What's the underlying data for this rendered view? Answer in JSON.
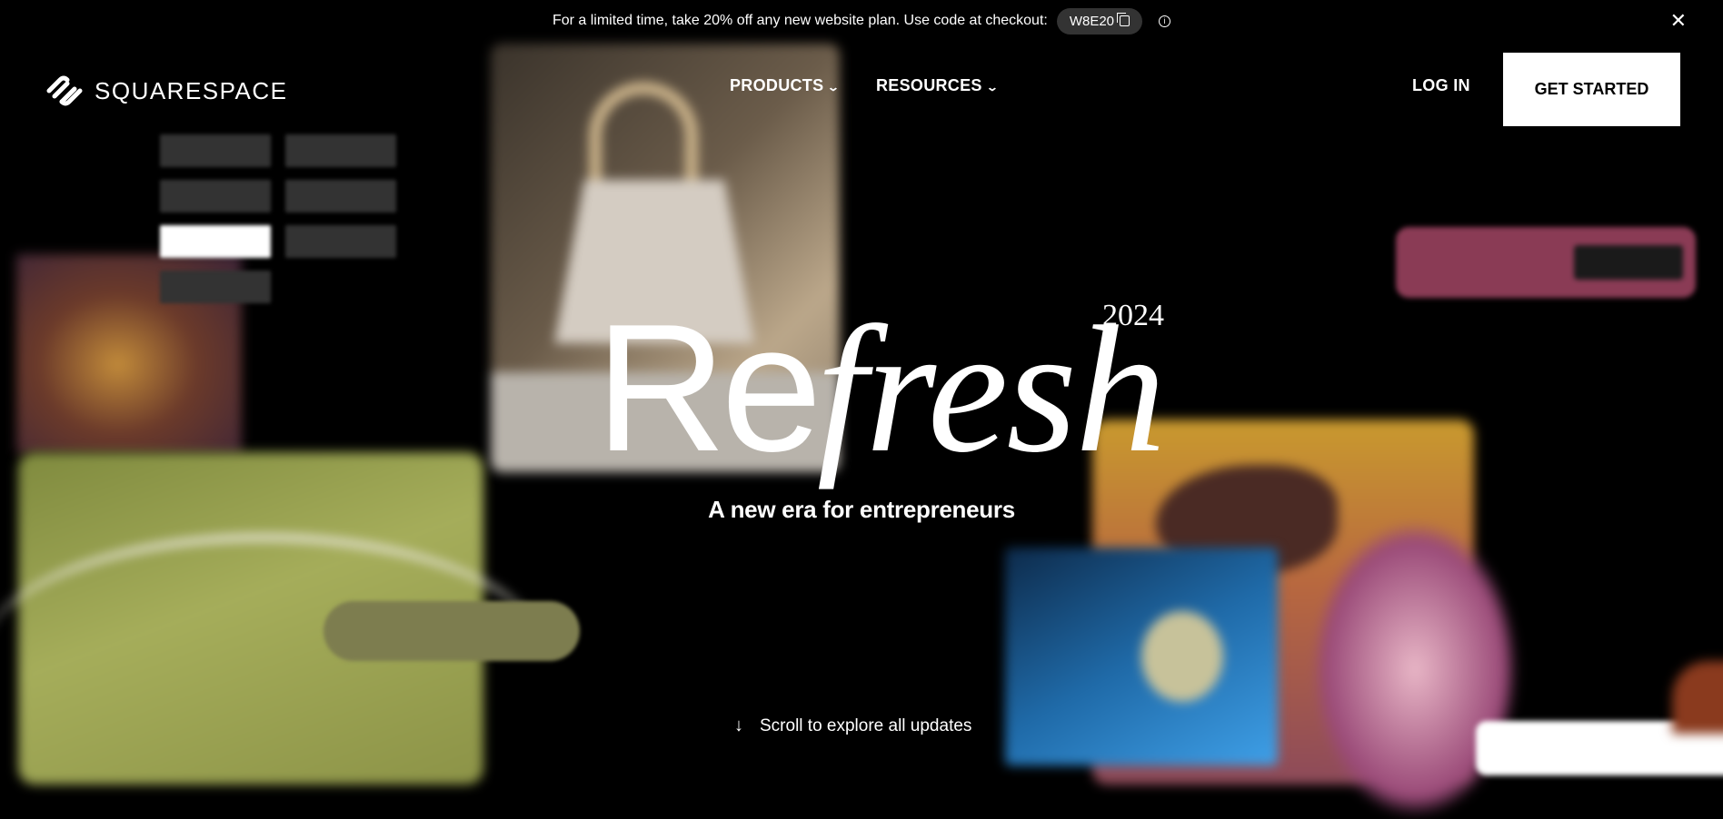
{
  "promo": {
    "text": "For a limited time, take 20% off any new website plan. Use code at checkout:",
    "code": "W8E20"
  },
  "nav": {
    "logo_text": "SQUARESPACE",
    "products": "PRODUCTS",
    "resources": "RESOURCES",
    "login": "LOG IN",
    "get_started": "GET STARTED"
  },
  "hero": {
    "title_upright": "Re",
    "title_italic": "fresh",
    "year": "2024",
    "subtitle": "A new era for entrepreneurs",
    "scroll_cta": "Scroll to explore all updates"
  },
  "icons": {
    "close": "close-icon",
    "copy": "copy-icon",
    "info": "info-icon",
    "chevron": "chevron-down-icon",
    "arrow": "arrow-down-icon"
  }
}
